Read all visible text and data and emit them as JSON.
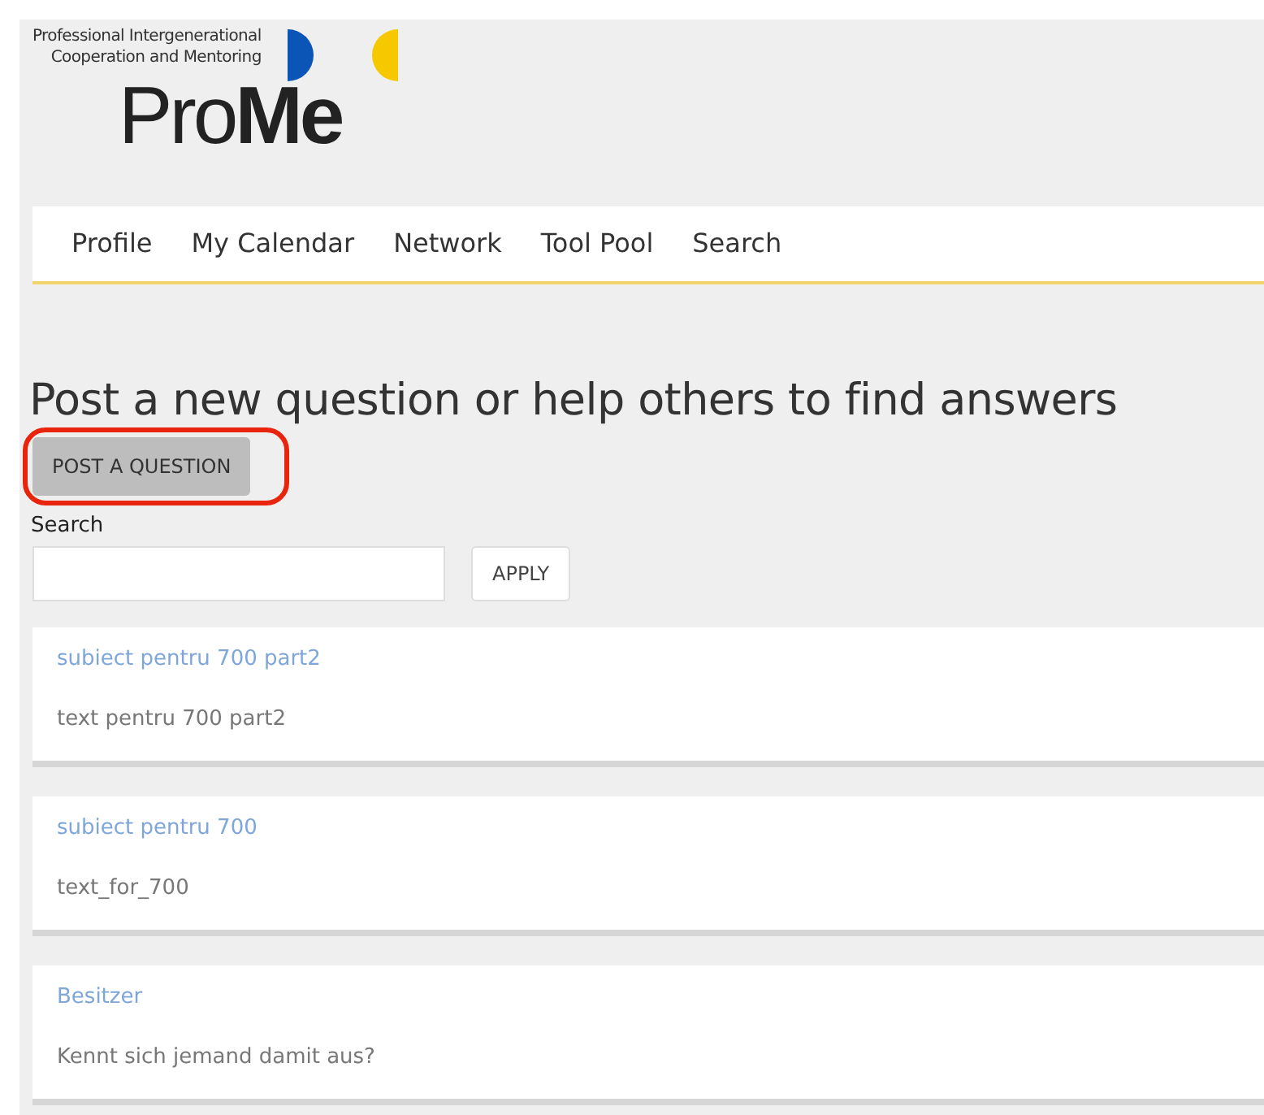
{
  "logo": {
    "tagline": [
      "Professional Intergenerational",
      "Cooperation and Mentoring"
    ],
    "wordmark": "Pro**Me**"
  },
  "nav": [
    "Profile",
    "My Calendar",
    "Network",
    "Tool Pool",
    "Search"
  ],
  "heading": "Post a new question or help others to find answers",
  "post_button": {
    "label": "POST A QUESTION",
    "highlighted": true
  },
  "search": {
    "label": "Search",
    "button": "APPLY"
  },
  "questions": [
    {
      "subject": "subiect pentru 700 part2",
      "text": "text pentru 700 part2"
    },
    {
      "subject": "subiect pentru 700",
      "text": "text_for_700"
    },
    {
      "subject": "Besitzer",
      "text": "Kennt sich jemand damit aus?"
    }
  ]
}
